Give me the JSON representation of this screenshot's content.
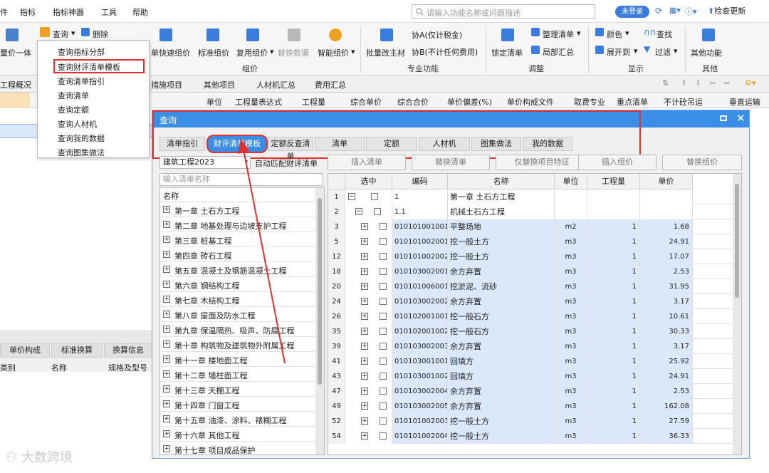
{
  "menubar": {
    "items": [
      "件",
      "指标",
      "指标神器",
      "工具",
      "帮助"
    ],
    "search_placeholder": "请输入功能名称或问题描述",
    "login": "未登录",
    "check_update": "检查更新"
  },
  "ribbon": {
    "left_partial": "量价一体",
    "query": "查询",
    "delete": "删除",
    "quick_price": "单快速组价",
    "standard_price": "标准组价",
    "reuse_price": "复用组价",
    "replace_data": "替换数据",
    "smart_price": "智能组价",
    "group_price": "组价",
    "batch_change": "批量改主材",
    "material_a": "协A(仅计税金)",
    "material_b": "协B(不计任何费用)",
    "group_special": "专业功能",
    "lock_list": "锁定清单",
    "sort_list": "整理清单",
    "local_summary": "局部汇总",
    "group_adjust": "调整",
    "color": "颜色",
    "find": "查找",
    "expand_to": "展开到",
    "filter": "过滤",
    "group_display": "显示",
    "other_functions": "其他功能",
    "group_other": "其他"
  },
  "dropdown": {
    "items": [
      "查询指标分部",
      "查询财评清单模板",
      "查询清单指引",
      "查询清单",
      "查询定额",
      "查询人材机",
      "查询我的数据",
      "查询图集做法"
    ]
  },
  "tabs": [
    "工程概况",
    "措施项目",
    "其他项目",
    "人材机汇总",
    "费用汇总"
  ],
  "headers": [
    "单位",
    "工程量表达式",
    "工程量",
    "综合单价",
    "综合合价",
    "单价偏差(%)",
    "单价构成文件",
    "取费专业",
    "重点清单",
    "不计砼吊运",
    "垂直运输"
  ],
  "bottom_tabs": [
    "单价构成",
    "标准换算",
    "换算信息"
  ],
  "bottom_headers": [
    "类别",
    "名称",
    "规格及型号"
  ],
  "dialog": {
    "title": "查询",
    "tabs": [
      "清单指引",
      "财评清单模板",
      "定额反查清单",
      "清单",
      "定额",
      "人材机",
      "图集做法",
      "我的数据"
    ],
    "active_tab": "财评清单模板",
    "select_value": "建筑工程2023",
    "auto_match": "自动匹配财评清单",
    "buttons": [
      "插入清单",
      "替换清单",
      "仅替换项目特征",
      "插入组价",
      "替换组价"
    ],
    "name_filter_placeholder": "输入清单名称",
    "tree_header": "名称",
    "tree_items": [
      "第一章 土石方工程",
      "第二章 地基处理与边坡支护工程",
      "第三章 桩基工程",
      "第四章  砖石工程",
      "第五章  混凝土及钢筋混凝土工程",
      "第六章  钢结构工程",
      "第七章  木结构工程",
      "第八章  屋面及防水工程",
      "第九章  保温隔热、吸声、防腐工程",
      "第十章  构筑物及建筑物外附属工程",
      "第十一章 楼地面工程",
      "第十二章 墙柱面工程",
      "第十三章 天棚工程",
      "第十四章 门窗工程",
      "第十五章 油漆、涂料、裱糊工程",
      "第十六章 其他工程",
      "第十七章 项目成品保护"
    ],
    "grid_headers": [
      "选中",
      "编码",
      "名称",
      "单位",
      "工程量",
      "单价"
    ],
    "grid_rows": [
      {
        "no": "1",
        "code": "1",
        "name": "第一章 土石方工程",
        "unit": "",
        "qty": "",
        "price": "",
        "level": 0
      },
      {
        "no": "2",
        "code": "1.1",
        "name": "机械土石方工程",
        "unit": "",
        "qty": "",
        "price": "",
        "level": 1
      },
      {
        "no": "3",
        "code": "010101001001",
        "name": "平整场地",
        "unit": "m2",
        "qty": "1",
        "price": "1.68",
        "level": 2
      },
      {
        "no": "5",
        "code": "010101002001",
        "name": "挖一般土方",
        "unit": "m3",
        "qty": "1",
        "price": "24.91",
        "level": 2
      },
      {
        "no": "12",
        "code": "010101002002",
        "name": "挖一般土方",
        "unit": "m3",
        "qty": "1",
        "price": "17.07",
        "level": 2
      },
      {
        "no": "18",
        "code": "010103002001",
        "name": "余方弃置",
        "unit": "m3",
        "qty": "1",
        "price": "2.53",
        "level": 2
      },
      {
        "no": "20",
        "code": "010101006001",
        "name": "挖淤泥、流砂",
        "unit": "m3",
        "qty": "1",
        "price": "31.95",
        "level": 2
      },
      {
        "no": "24",
        "code": "010103002002",
        "name": "余方弃置",
        "unit": "m3",
        "qty": "1",
        "price": "3.17",
        "level": 2
      },
      {
        "no": "26",
        "code": "010102001001",
        "name": "挖一般石方",
        "unit": "m3",
        "qty": "1",
        "price": "10.61",
        "level": 2
      },
      {
        "no": "35",
        "code": "010102001002",
        "name": "挖一般石方",
        "unit": "m3",
        "qty": "1",
        "price": "30.33",
        "level": 2
      },
      {
        "no": "39",
        "code": "010103002003",
        "name": "余方弃置",
        "unit": "m3",
        "qty": "1",
        "price": "3.17",
        "level": 2
      },
      {
        "no": "41",
        "code": "010103001001",
        "name": "回填方",
        "unit": "m3",
        "qty": "1",
        "price": "25.92",
        "level": 2
      },
      {
        "no": "43",
        "code": "010103001002",
        "name": "回填方",
        "unit": "m3",
        "qty": "1",
        "price": "24.91",
        "level": 2
      },
      {
        "no": "47",
        "code": "010103002004",
        "name": "余方弃置",
        "unit": "m3",
        "qty": "1",
        "price": "2.53",
        "level": 2
      },
      {
        "no": "49",
        "code": "010103002005",
        "name": "余方弃置",
        "unit": "m3",
        "qty": "1",
        "price": "162.08",
        "level": 2
      },
      {
        "no": "52",
        "code": "010101002003",
        "name": "挖一般土方",
        "unit": "m3",
        "qty": "1",
        "price": "27.59",
        "level": 2
      },
      {
        "no": "54",
        "code": "010101002004",
        "name": "挖一般土方",
        "unit": "m3",
        "qty": "1",
        "price": "36.33",
        "level": 2
      }
    ]
  },
  "watermark": "大数跨境",
  "colors": {
    "accent": "#3a8ee6",
    "highlight_red": "#e53030",
    "row_blue": "#dbe8fa"
  }
}
